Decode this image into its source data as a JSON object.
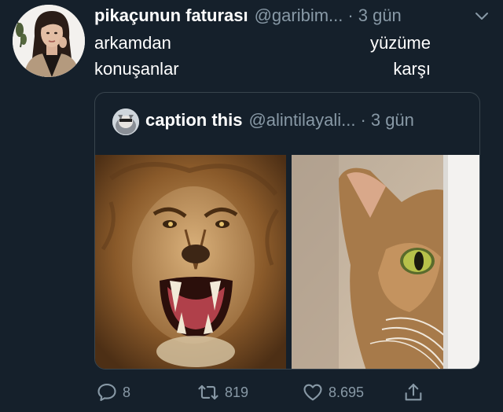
{
  "tweet": {
    "display_name": "pikaçunun faturası",
    "handle": "@garibim...",
    "separator": "·",
    "time": "3 gün",
    "lines": [
      {
        "left": "arkamdan",
        "right": "yüzüme"
      },
      {
        "left": "konuşanlar",
        "right": "karşı"
      }
    ]
  },
  "quote": {
    "display_name": "caption this",
    "handle": "@alintilayali...",
    "separator": "·",
    "time": "3 gün"
  },
  "actions": {
    "reply_count": "8",
    "retweet_count": "819",
    "like_count": "8.695"
  },
  "icons": {
    "caret": "chevron-down-icon",
    "reply": "reply-icon",
    "retweet": "retweet-icon",
    "like": "heart-icon",
    "share": "share-icon"
  },
  "colors": {
    "background": "#15202b",
    "secondary_text": "#8899a6",
    "border": "#38444d"
  }
}
